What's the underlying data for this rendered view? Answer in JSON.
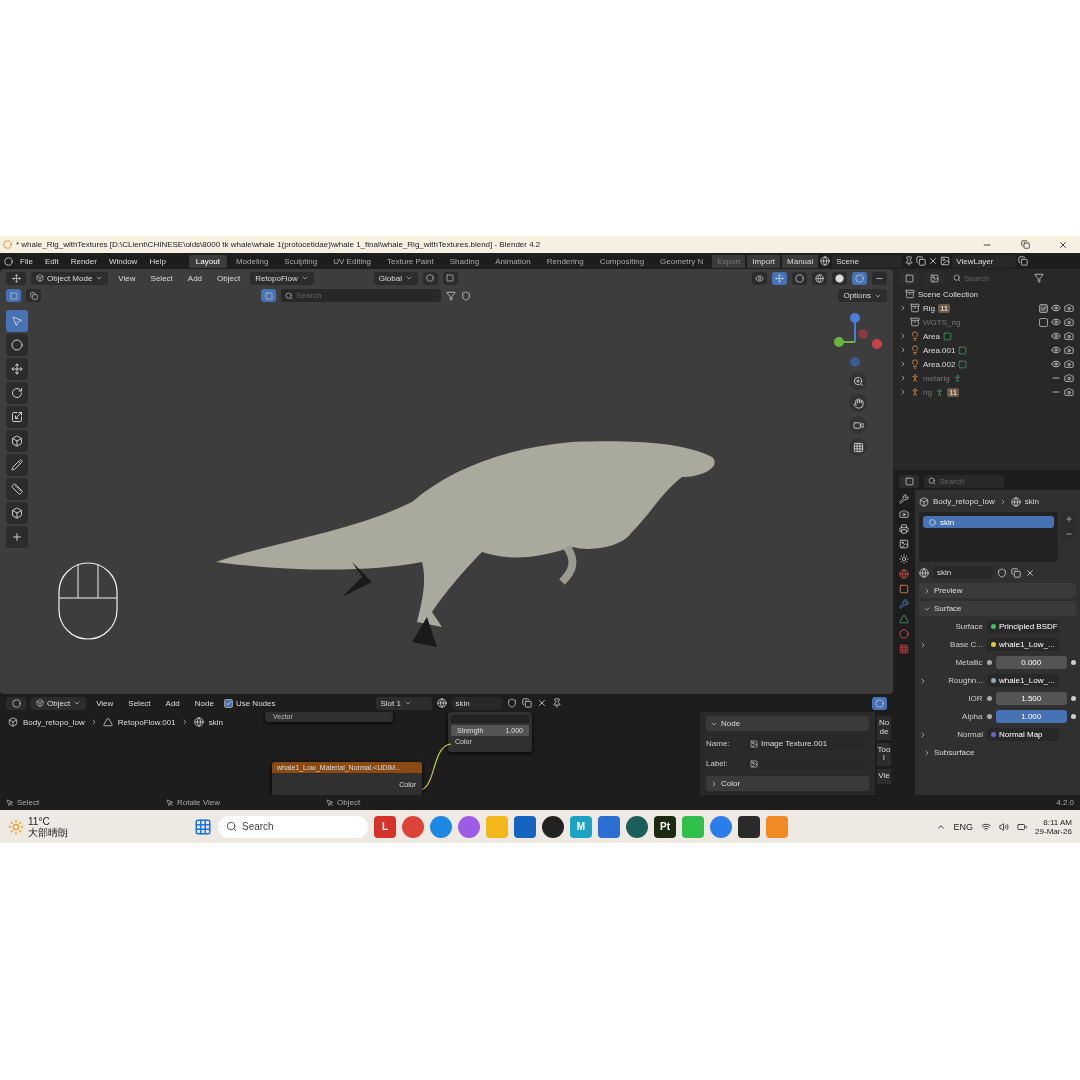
{
  "window": {
    "title": "* whale_Rig_withTextures [D:\\CLient\\CHINESE\\olds\\8000 tk whale\\whale 1(protocetidae)\\whale 1_final\\whale_Rig_withTextures.blend] - Blender 4.2"
  },
  "menu": [
    "File",
    "Edit",
    "Render",
    "Window",
    "Help"
  ],
  "workspaces": [
    {
      "label": "Layout",
      "selected": true
    },
    {
      "label": "Modeling",
      "selected": false
    },
    {
      "label": "Sculpting",
      "selected": false
    },
    {
      "label": "UV Editing",
      "selected": false
    },
    {
      "label": "Texture Paint",
      "selected": false
    },
    {
      "label": "Shading",
      "selected": false
    },
    {
      "label": "Animation",
      "selected": false
    },
    {
      "label": "Rendering",
      "selected": false
    },
    {
      "label": "Compositing",
      "selected": false
    },
    {
      "label": "Geometry N",
      "selected": false
    }
  ],
  "addon_buttons": [
    {
      "label": "Export",
      "disabled": true
    },
    {
      "label": "Import",
      "disabled": false
    },
    {
      "label": "Manual",
      "disabled": false
    }
  ],
  "scene": "Scene",
  "view_layer": "ViewLayer",
  "viewport_header": {
    "mode": "Object Mode",
    "menus": [
      "View",
      "Select",
      "Add",
      "Object"
    ],
    "addon": "RetopoFlow",
    "orientation": "Global",
    "search_placeholder": "Search",
    "options": "Options"
  },
  "outliner": {
    "search_placeholder": "Search",
    "root": "Scene Collection",
    "items": [
      {
        "name": "Rig",
        "kind": "collection",
        "expandable": true,
        "dimmed": false,
        "badge": "11",
        "checked": true,
        "visible": true
      },
      {
        "name": "WGTS_rig",
        "kind": "collection",
        "expandable": false,
        "dimmed": true,
        "checked": false,
        "visible": true
      },
      {
        "name": "Area",
        "kind": "light",
        "expandable": true,
        "dimmed": false,
        "visible": true
      },
      {
        "name": "Area.001",
        "kind": "light",
        "expandable": true,
        "dimmed": false,
        "visible": true
      },
      {
        "name": "Area.002",
        "kind": "light",
        "expandable": true,
        "dimmed": false,
        "visible": true
      },
      {
        "name": "metarig",
        "kind": "armature",
        "expandable": true,
        "dimmed": true,
        "visible": false
      },
      {
        "name": "rig",
        "kind": "armature",
        "expandable": true,
        "dimmed": true,
        "badge": "11",
        "visible": false
      }
    ]
  },
  "properties": {
    "search_placeholder": "Search",
    "breadcrumb": [
      "Body_retopo_low",
      "skin"
    ],
    "slots": [
      {
        "name": "skin",
        "selected": true
      }
    ],
    "material": "skin",
    "panels": [
      {
        "label": "Preview",
        "expanded": false
      },
      {
        "label": "Surface",
        "expanded": true
      }
    ],
    "fields": [
      {
        "label": "Surface",
        "kind": "link",
        "value": "Principled BSDF",
        "color": "#3fbf5f",
        "expandable": false
      },
      {
        "label": "Base C...",
        "kind": "link",
        "value": "whale1_Low_...",
        "color": "#d8c83a",
        "expandable": true
      },
      {
        "label": "Metallic",
        "kind": "number",
        "value": "0.000",
        "selected": false,
        "expandable": false
      },
      {
        "label": "Roughn...",
        "kind": "link",
        "value": "whale1_Low_...",
        "color": "#9aa4b8",
        "expandable": true
      },
      {
        "label": "IOR",
        "kind": "number",
        "value": "1.500",
        "selected": false,
        "expandable": false
      },
      {
        "label": "Alpha",
        "kind": "number",
        "value": "1.000",
        "selected": true,
        "expandable": false
      },
      {
        "label": "Normal",
        "kind": "link",
        "value": "Normal Map",
        "color": "#6a63d0",
        "expandable": true
      }
    ],
    "subpanel": "Subsurface",
    "version": "4.2.0"
  },
  "node_editor": {
    "type": "Object",
    "menus": [
      "View",
      "Select",
      "Add",
      "Node"
    ],
    "use_nodes": {
      "label": "Use Nodes",
      "checked": true
    },
    "slot": "Slot 1",
    "material": "skin",
    "breadcrumb": [
      "Body_retopo_low",
      "RetopoFlow.001",
      "skin"
    ],
    "vector_label": "Vector",
    "strength_label": "Strength",
    "strength_value": "1.000",
    "color_input": "Color",
    "image_node": "whale1_Low_Material_Normal.<UDIM...",
    "image_output": "Color",
    "sidebar": {
      "heading": "Node",
      "name_label": "Name:",
      "name_value": "Image Texture.001",
      "label_label": "Label:",
      "subpanel": "Color"
    },
    "tabs": [
      "Node",
      "Tool",
      "Vie"
    ]
  },
  "status_bar": [
    "Select",
    "Rotate View",
    "Object"
  ],
  "taskbar": {
    "temperature": "11°C",
    "weather": "大部晴朗",
    "search_placeholder": "Search",
    "language": "ENG",
    "time": "8:11 AM",
    "date": "29-Mar-26",
    "apps": [
      {
        "kind": "tile",
        "label": "L",
        "color": "#d6322b"
      },
      {
        "kind": "circle",
        "color": "#db4437"
      },
      {
        "kind": "circle",
        "color": "#1e88e5"
      },
      {
        "kind": "circle",
        "color": "#9c5ce6"
      },
      {
        "kind": "tile",
        "color": "#f2b81a"
      },
      {
        "kind": "tile",
        "color": "#1565c0"
      },
      {
        "kind": "circle",
        "color": "#222222"
      },
      {
        "kind": "tile",
        "label": "M",
        "color": "#1ba3c6"
      },
      {
        "kind": "tile",
        "color": "#2a6fd1"
      },
      {
        "kind": "circle",
        "color": "#1c5f5a"
      },
      {
        "kind": "tile",
        "label": "Pt",
        "color": "#1c2a12"
      },
      {
        "kind": "tile",
        "color": "#2fbf4a"
      },
      {
        "kind": "circle",
        "color": "#2b7de9"
      },
      {
        "kind": "tile",
        "color": "#2b2b2b"
      },
      {
        "kind": "tile",
        "color": "#f08a24"
      }
    ]
  }
}
